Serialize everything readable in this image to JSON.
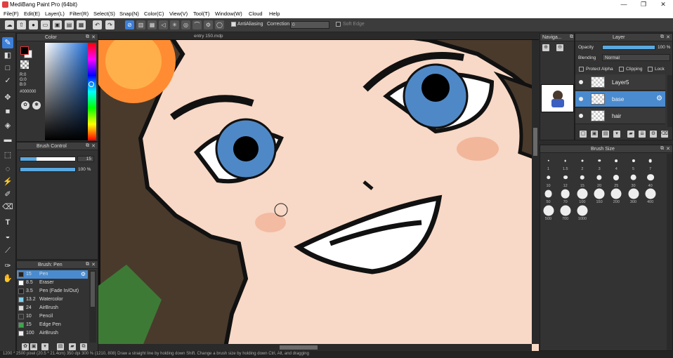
{
  "window": {
    "title": "MediBang Paint Pro (64bit)",
    "minimize": "—",
    "maximize": "❐",
    "close": "✕"
  },
  "menu": [
    "File(F)",
    "Edit(E)",
    "Layer(L)",
    "Filter(R)",
    "Select(S)",
    "Snap(N)",
    "Color(C)",
    "View(V)",
    "Tool(T)",
    "Window(W)",
    "Cloud",
    "Help"
  ],
  "toolbar": {
    "antialiasing_label": "AntiAliasing",
    "correction_label": "Correction",
    "correction_value": "0",
    "soft_edge_label": "Soft Edge"
  },
  "document": {
    "tab_title": "entry 150.mdp"
  },
  "color_panel": {
    "title": "Color",
    "r": "R:0",
    "g": "G:0",
    "b": "B:0",
    "hex": "#000000"
  },
  "brush_control": {
    "title": "Brush Control",
    "size_value": "15",
    "opacity_value": "100 %"
  },
  "brush_panel": {
    "title": "Brush: Pen",
    "items": [
      {
        "size": "15",
        "name": "Pen",
        "color": "#222222",
        "selected": true
      },
      {
        "size": "8.5",
        "name": "Eraser",
        "color": "#ffffff",
        "selected": false
      },
      {
        "size": "3.5",
        "name": "Pen (Fade In/Out)",
        "color": "#222222",
        "selected": false
      },
      {
        "size": "13.2",
        "name": "Watercolor",
        "color": "#7fd0f0",
        "selected": false
      },
      {
        "size": "24",
        "name": "AirBrush",
        "color": "#dddddd",
        "selected": false
      },
      {
        "size": "10",
        "name": "Pencil",
        "color": "#333333",
        "selected": false
      },
      {
        "size": "15",
        "name": "Edge Pen",
        "color": "#3aa84a",
        "selected": false
      },
      {
        "size": "100",
        "name": "AirBrush",
        "color": "#eeeeee",
        "selected": false
      }
    ]
  },
  "navigator": {
    "title": "Naviga..."
  },
  "layer_panel": {
    "title": "Layer",
    "opacity_label": "Opacity",
    "opacity_value": "100 %",
    "blending_label": "Blending",
    "blending_value": "Normal",
    "protect_alpha": "Protect Alpha",
    "clipping": "Clipping",
    "lock": "Lock",
    "layers": [
      {
        "name": "Layer5",
        "selected": false
      },
      {
        "name": "base",
        "selected": true
      },
      {
        "name": "hair",
        "selected": false
      }
    ]
  },
  "brush_size_panel": {
    "title": "Brush Size",
    "sizes": [
      "1",
      "1.5",
      "2",
      "3",
      "4",
      "5",
      "7",
      "10",
      "12",
      "15",
      "20",
      "25",
      "30",
      "40",
      "50",
      "70",
      "100",
      "150",
      "200",
      "300",
      "400",
      "500",
      "700",
      "1000"
    ]
  },
  "status": {
    "text": "1200 * 2500 pixel   (20.5 * 21.4cm)   350 dpi   300 %   (1210, 808)   Draw a straight line by holding down Shift. Change a brush size by holding down Ctrl, Alt, and dragging"
  }
}
